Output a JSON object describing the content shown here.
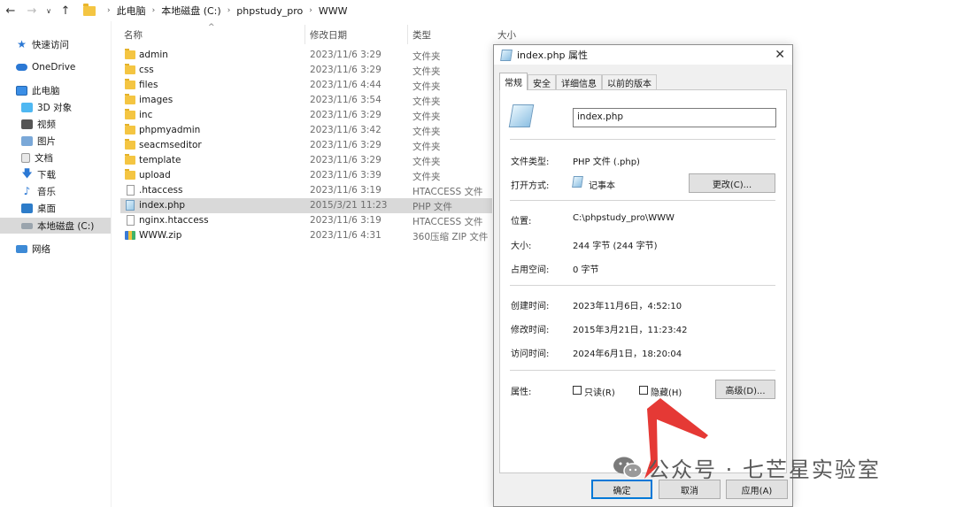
{
  "address_bar": {
    "back_icon": "arrow-left-icon",
    "forward_icon": "arrow-right-icon",
    "recent_icon": "chevron-down-icon",
    "up_icon": "arrow-up-icon",
    "crumbs": [
      "此电脑",
      "本地磁盘 (C:)",
      "phpstudy_pro",
      "WWW"
    ]
  },
  "nav": {
    "items": [
      {
        "label": "快速访问",
        "icon": "star-icon"
      },
      {
        "label": "OneDrive",
        "icon": "cloud-icon"
      },
      {
        "label": "此电脑",
        "icon": "computer-icon"
      },
      {
        "label": "3D 对象",
        "icon": "cube-icon"
      },
      {
        "label": "视频",
        "icon": "video-icon"
      },
      {
        "label": "图片",
        "icon": "picture-icon"
      },
      {
        "label": "文档",
        "icon": "document-icon"
      },
      {
        "label": "下载",
        "icon": "download-icon"
      },
      {
        "label": "音乐",
        "icon": "music-icon"
      },
      {
        "label": "桌面",
        "icon": "desktop-icon"
      },
      {
        "label": "本地磁盘 (C:)",
        "icon": "drive-icon"
      },
      {
        "label": "网络",
        "icon": "network-icon"
      }
    ]
  },
  "file_list": {
    "columns": {
      "name": "名称",
      "date": "修改日期",
      "type": "类型",
      "size": "大小"
    },
    "rows": [
      {
        "name": "admin",
        "date": "2023/11/6 3:29",
        "type": "文件夹",
        "icon": "folder-icon"
      },
      {
        "name": "css",
        "date": "2023/11/6 3:29",
        "type": "文件夹",
        "icon": "folder-icon"
      },
      {
        "name": "files",
        "date": "2023/11/6 4:44",
        "type": "文件夹",
        "icon": "folder-icon"
      },
      {
        "name": "images",
        "date": "2023/11/6 3:54",
        "type": "文件夹",
        "icon": "folder-icon"
      },
      {
        "name": "inc",
        "date": "2023/11/6 3:29",
        "type": "文件夹",
        "icon": "folder-icon"
      },
      {
        "name": "phpmyadmin",
        "date": "2023/11/6 3:42",
        "type": "文件夹",
        "icon": "folder-icon"
      },
      {
        "name": "seacmseditor",
        "date": "2023/11/6 3:29",
        "type": "文件夹",
        "icon": "folder-icon"
      },
      {
        "name": "template",
        "date": "2023/11/6 3:29",
        "type": "文件夹",
        "icon": "folder-icon"
      },
      {
        "name": "upload",
        "date": "2023/11/6 3:39",
        "type": "文件夹",
        "icon": "folder-icon"
      },
      {
        "name": ".htaccess",
        "date": "2023/11/6 3:19",
        "type": "HTACCESS 文件",
        "icon": "file-icon"
      },
      {
        "name": "index.php",
        "date": "2015/3/21 11:23",
        "type": "PHP 文件",
        "icon": "php-file-icon",
        "selected": true
      },
      {
        "name": "nginx.htaccess",
        "date": "2023/11/6 3:19",
        "type": "HTACCESS 文件",
        "icon": "file-icon"
      },
      {
        "name": "WWW.zip",
        "date": "2023/11/6 4:31",
        "type": "360压缩 ZIP 文件",
        "icon": "zip-icon"
      }
    ]
  },
  "dialog": {
    "title": "index.php 属性",
    "close_icon": "close-icon",
    "tabs": [
      "常规",
      "安全",
      "详细信息",
      "以前的版本"
    ],
    "active_tab": "常规",
    "file_name": "index.php",
    "file_type_label": "文件类型:",
    "file_type": "PHP 文件 (.php)",
    "open_with_label": "打开方式:",
    "open_with": "记事本",
    "change_button": "更改(C)...",
    "location_label": "位置:",
    "location": "C:\\phpstudy_pro\\WWW",
    "size_label": "大小:",
    "size": "244 字节 (244 字节)",
    "disk_size_label": "占用空间:",
    "disk_size": "0 字节",
    "created_label": "创建时间:",
    "created": "2023年11月6日，4:52:10",
    "modified_label": "修改时间:",
    "modified": "2015年3月21日，11:23:42",
    "accessed_label": "访问时间:",
    "accessed": "2024年6月1日，18:20:04",
    "attributes_label": "属性:",
    "readonly_label": "只读(R)",
    "hidden_label": "隐藏(H)",
    "advanced_button": "高级(D)...",
    "ok_button": "确定",
    "cancel_button": "取消",
    "apply_button": "应用(A)"
  },
  "annotation": {
    "arrow_color": "#e53935"
  },
  "watermark": {
    "text": "公众号 · 七芒星实验室",
    "icon": "wechat-icon"
  }
}
